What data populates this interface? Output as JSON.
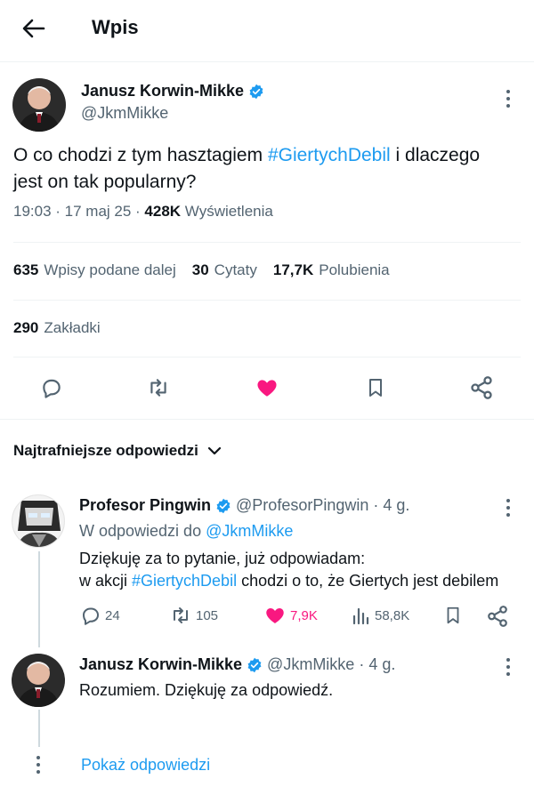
{
  "header": {
    "title": "Wpis"
  },
  "main_tweet": {
    "author_name": "Janusz Korwin-Mikke",
    "handle": "@JkmMikke",
    "text_part1": "O co chodzi z tym hasztagiem ",
    "hashtag": "#GiertychDebil",
    "text_part2": " i dlaczego jest on tak popularny?",
    "time": "19:03 · 17 maj 25 · ",
    "views_count": "428K",
    "views_label": "Wyświetlenia",
    "reposts_count": "635",
    "reposts_label": "Wpisy podane dalej",
    "quotes_count": "30",
    "quotes_label": "Cytaty",
    "likes_count": "17,7K",
    "likes_label": "Polubienia",
    "bookmarks_count": "290",
    "bookmarks_label": "Zakładki"
  },
  "sort": {
    "label": "Najtrafniejsze odpowiedzi"
  },
  "replies": [
    {
      "author_name": "Profesor Pingwin",
      "handle_time": "@ProfesorPingwin · 4 g.",
      "reply_to_prefix": "W odpowiedzi do ",
      "reply_to_handle": "@JkmMikke",
      "text_line1": "Dziękuję za to pytanie, już odpowiadam:",
      "text_line2_part1": "w akcji ",
      "text_line2_hashtag": "#GiertychDebil",
      "text_line2_part2": " chodzi o to, że Giertych jest debilem",
      "replies_count": "24",
      "reposts_count": "105",
      "likes_count": "7,9K",
      "views_count": "58,8K"
    },
    {
      "author_name": "Janusz Korwin-Mikke",
      "handle_time": "@JkmMikke · 4 g.",
      "text": "Rozumiem. Dziękuję za odpowiedź."
    }
  ],
  "show_replies": {
    "label": "Pokaż odpowiedzi"
  },
  "colors": {
    "accent": "#1d9bf0",
    "like": "#f91880",
    "secondary": "#536471"
  }
}
